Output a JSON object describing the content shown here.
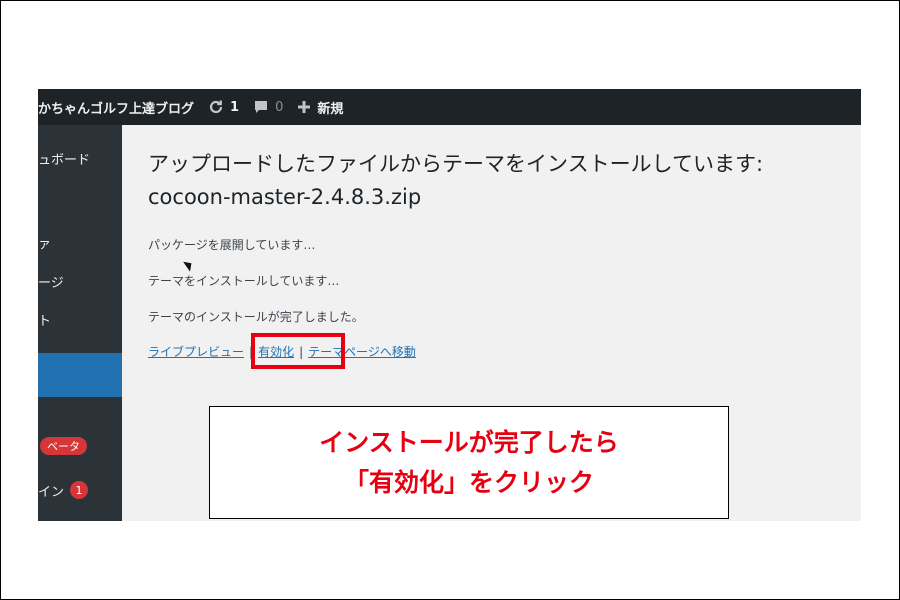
{
  "admin_bar": {
    "site_name": "かちゃんゴルフ上達ブログ",
    "updates_count": "1",
    "comments_count": "0",
    "new_label": "新規"
  },
  "sidebar": {
    "items": [
      {
        "label": "ュボード"
      },
      {
        "label": "ァ"
      },
      {
        "label": "ージ"
      },
      {
        "label": "ト"
      }
    ],
    "beta_badge": "ベータ",
    "plugins_label": "イン",
    "plugins_badge": "1"
  },
  "main": {
    "title": "アップロードしたファイルからテーマをインストールしています: cocoon-master-2.4.8.3.zip",
    "messages": [
      "パッケージを展開しています…",
      "テーマをインストールしています…",
      "テーマのインストールが完了しました。"
    ],
    "links": {
      "live_preview": "ライブプレビュー",
      "activate": "有効化",
      "theme_page": "テーマページへ移動",
      "separator": "|"
    }
  },
  "callout": {
    "line1": "インストールが完了したら",
    "line2": "「有効化」をクリック"
  },
  "colors": {
    "admin_bar": "#1d2327",
    "sidebar": "#2c3338",
    "active_menu": "#2271b1",
    "link": "#2271b1",
    "annotation_red": "#e60012"
  }
}
